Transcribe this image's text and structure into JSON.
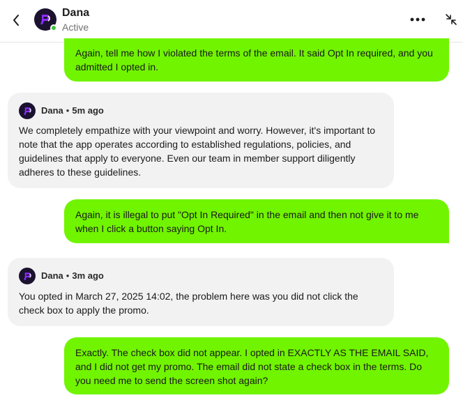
{
  "header": {
    "contact_name": "Dana",
    "status": "Active",
    "icons": {
      "back": "chevron-left-icon",
      "more": "more-horizontal-icon",
      "collapse": "collapse-arrows-icon"
    }
  },
  "colors": {
    "outgoing_bubble": "#71f400",
    "incoming_bubble": "#f2f2f2",
    "brand_purple": "#8b2cff",
    "online_dot": "#3fbf3a"
  },
  "messages": [
    {
      "direction": "outgoing",
      "text": "Again, tell me how I violated the terms of the email. It said Opt In required, and you admitted I opted in."
    },
    {
      "direction": "incoming",
      "sender": "Dana",
      "separator": "•",
      "time": "5m ago",
      "text": "We completely empathize with your viewpoint and worry. However, it's important to note that the app operates according to established regulations, policies, and guidelines that apply to everyone. Even our team in member support diligently adheres to these guidelines."
    },
    {
      "direction": "outgoing",
      "text": "Again, it is illegal to put \"Opt In Required\" in the email and then not give it to me when I click a button saying Opt In."
    },
    {
      "direction": "incoming",
      "sender": "Dana",
      "separator": "•",
      "time": "3m ago",
      "text": "You opted in March 27, 2025 14:02, the problem here was you did not click the check box to apply the promo."
    },
    {
      "direction": "outgoing",
      "text": "Exactly. The check box did not appear. I opted in EXACTLY AS THE EMAIL SAID, and I did not get my promo. The email did not state a check box in the terms. Do you need me to send the screen shot again?"
    }
  ]
}
